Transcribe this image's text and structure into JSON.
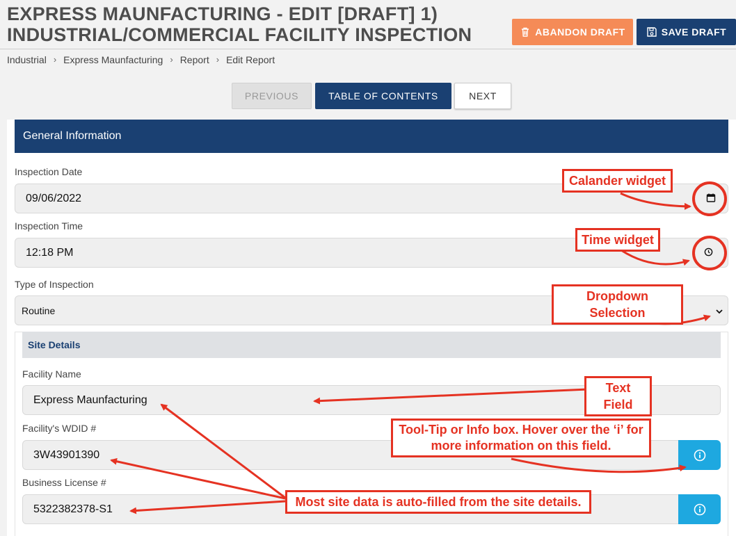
{
  "header": {
    "title_line1": "EXPRESS MAUNFACTURING - EDIT [DRAFT] 1)",
    "title_line2": "INDUSTRIAL/COMMERCIAL FACILITY INSPECTION",
    "abandon_label": "ABANDON DRAFT",
    "save_label": "SAVE DRAFT"
  },
  "breadcrumb": [
    "Industrial",
    "Express Maunfacturing",
    "Report",
    "Edit Report"
  ],
  "nav": {
    "previous": "PREVIOUS",
    "toc": "TABLE OF CONTENTS",
    "next": "NEXT"
  },
  "section": {
    "title": "General Information",
    "inspection_date": {
      "label": "Inspection Date",
      "value": "09/06/2022"
    },
    "inspection_time": {
      "label": "Inspection Time",
      "value": "12:18 PM"
    },
    "inspection_type": {
      "label": "Type of Inspection",
      "value": "Routine"
    }
  },
  "site": {
    "title": "Site Details",
    "facility_name": {
      "label": "Facility Name",
      "value": "Express Maunfacturing"
    },
    "wdid": {
      "label": "Facility's WDID #",
      "value": "3W43901390"
    },
    "business_license": {
      "label": "Business License #",
      "value": "5322382378-S1"
    }
  },
  "annotations": {
    "calendar": "Calander widget",
    "time": "Time widget",
    "dropdown": "Dropdown Selection",
    "text_field": "Text Field",
    "tooltip": "Tool-Tip or Info box. Hover over the ‘i’ for more information on this field.",
    "autofill": "Most site data is auto-filled from the site details."
  },
  "colors": {
    "navy": "#1a4072",
    "orange": "#f58b57",
    "info": "#1ea8e0",
    "annotation_red": "#e53222"
  }
}
